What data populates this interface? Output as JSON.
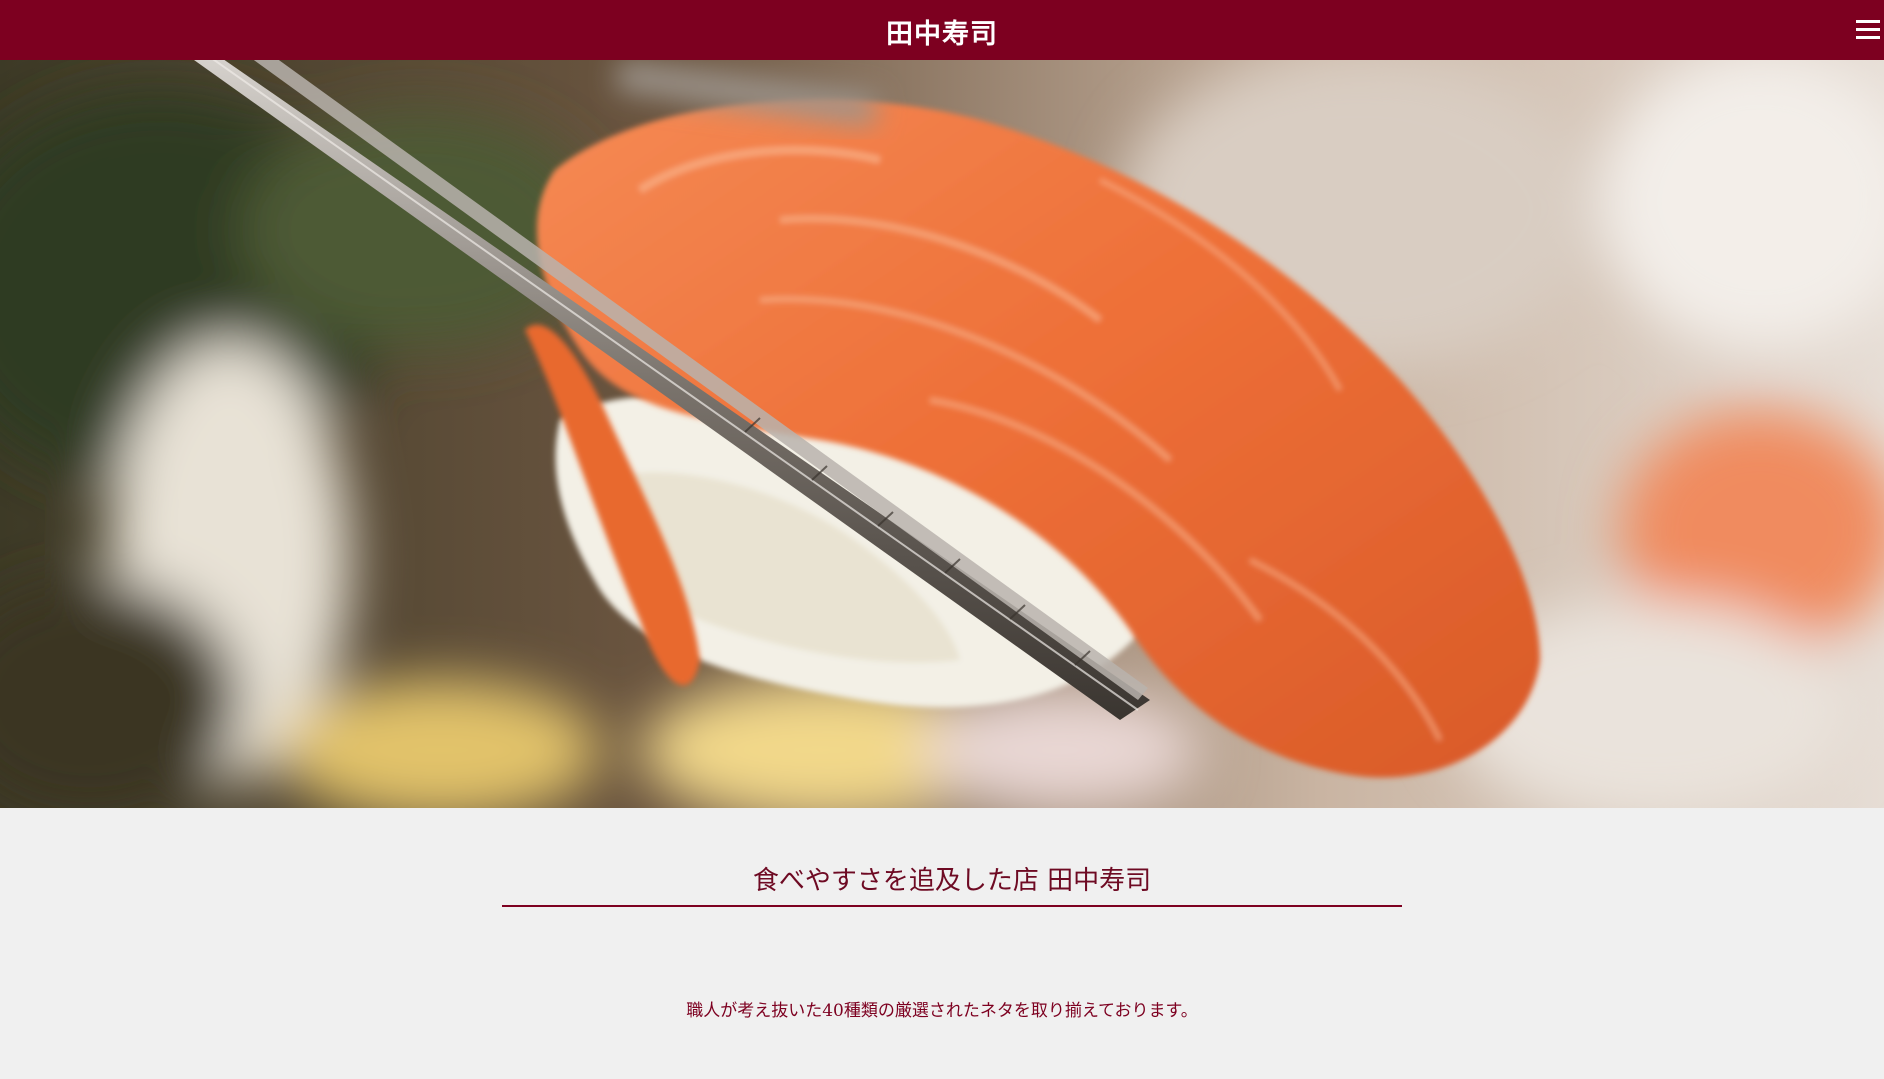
{
  "header": {
    "site_title": "田中寿司",
    "menu_icon": "hamburger-menu-icon",
    "background_color": "#7d0020"
  },
  "hero": {
    "image": "salmon-nigiri-held-by-chopsticks"
  },
  "intro": {
    "heading": "食べやすさを追及した店 田中寿司",
    "lead": "職人が考え抜いた40種類の厳選されたネタを取り揃えております。"
  },
  "colors": {
    "accent": "#7d0020",
    "page_background": "#f0f0f0"
  }
}
